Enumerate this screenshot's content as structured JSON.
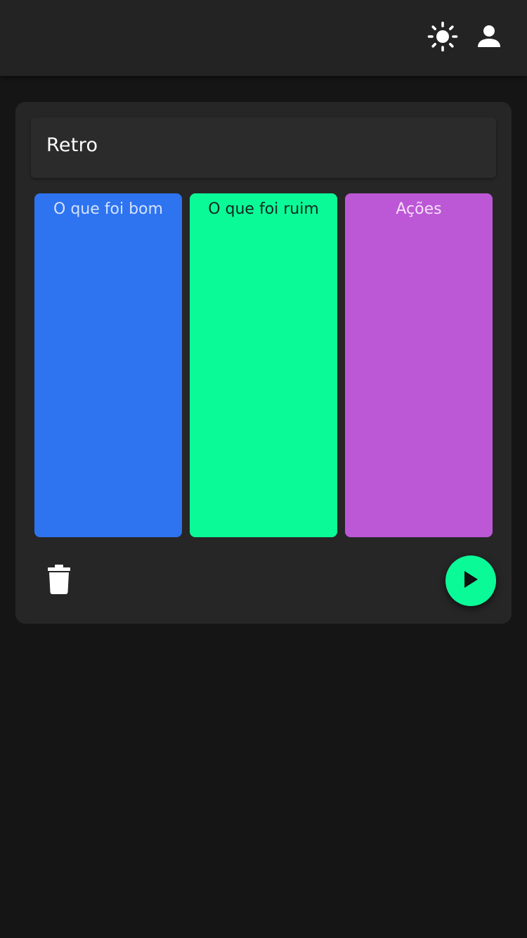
{
  "app_bar": {
    "theme_icon": "sun-icon",
    "profile_icon": "person-icon"
  },
  "board": {
    "title": "Retro",
    "columns": [
      {
        "label": "O que foi bom",
        "color": "#2e73f0"
      },
      {
        "label": "O que foi ruim",
        "color": "#0bfa98"
      },
      {
        "label": "Ações",
        "color": "#bc57d6"
      }
    ],
    "delete_icon": "trash-icon",
    "start_icon": "play-icon",
    "accent_color": "#0bfa98"
  }
}
